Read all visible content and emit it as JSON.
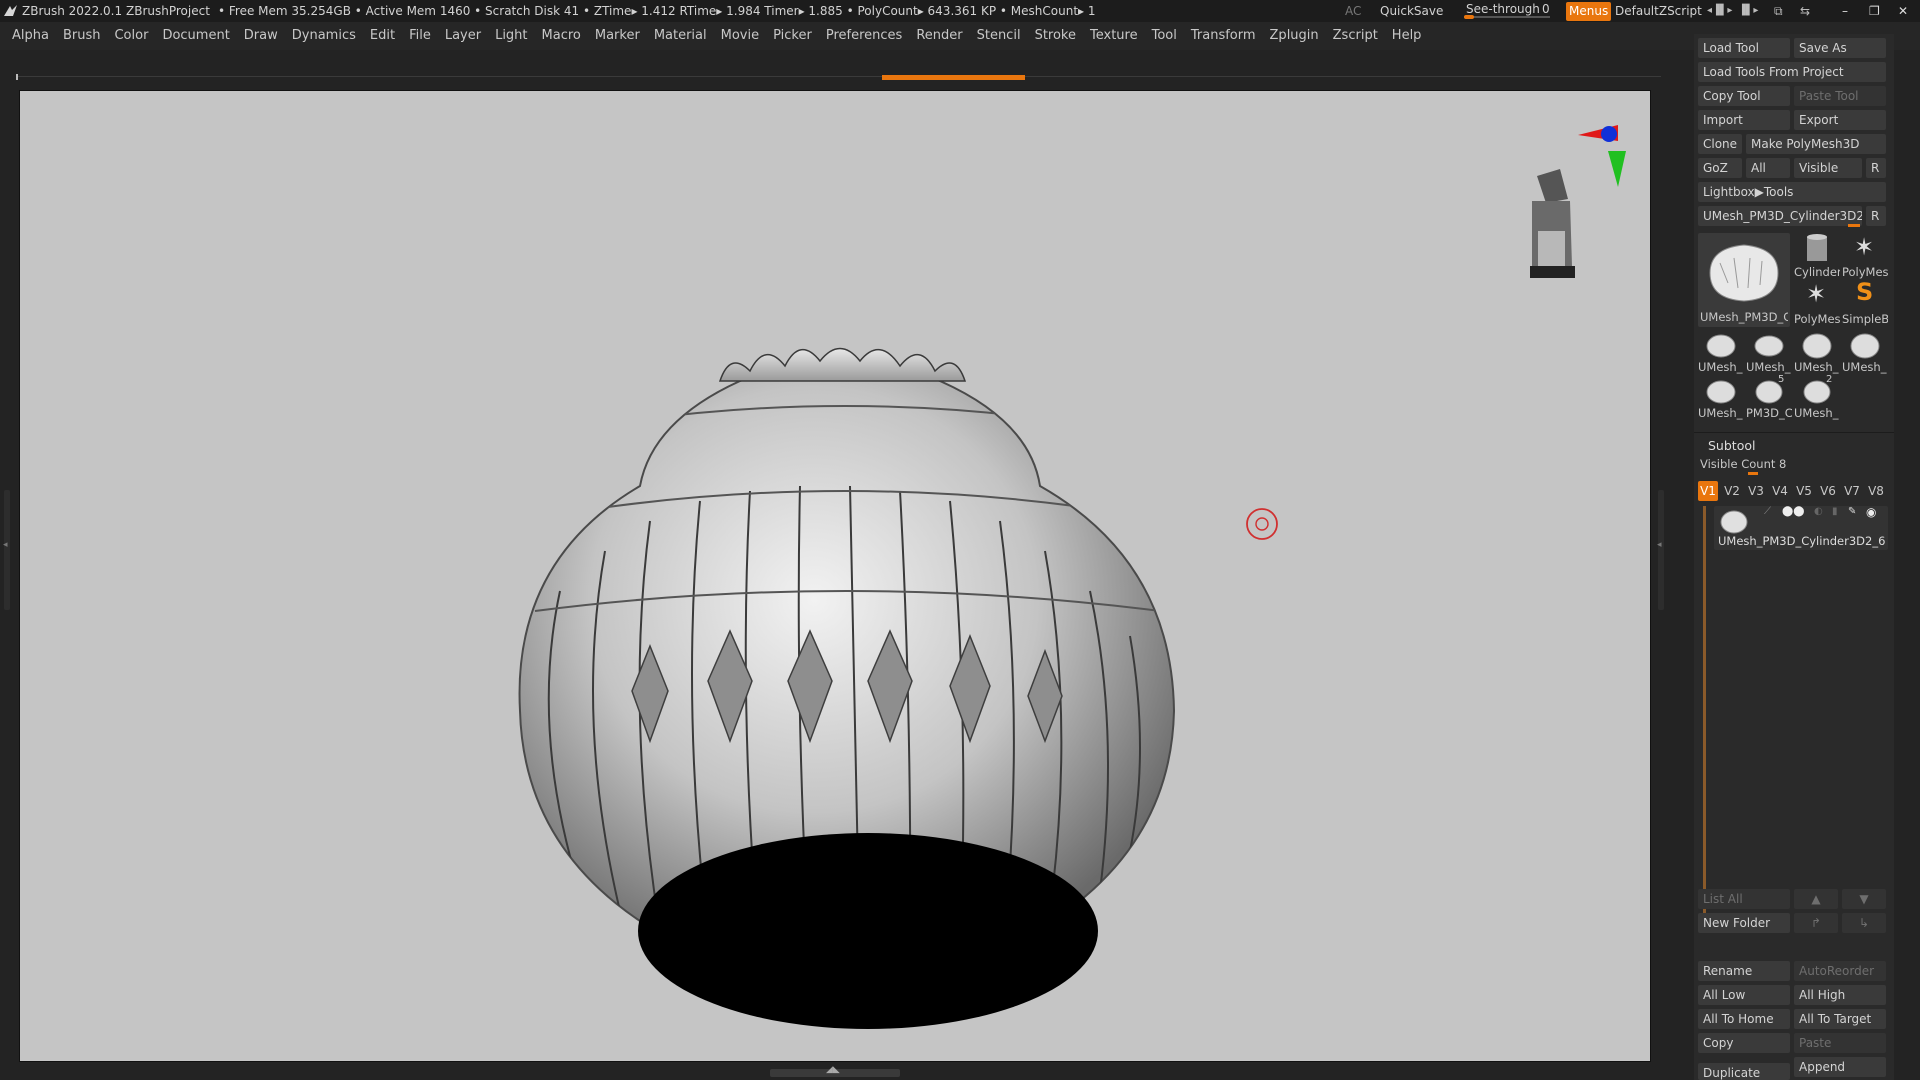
{
  "titlebar": {
    "app": "ZBrush 2022.0.1",
    "project": "ZBrushProject",
    "stats": "• Free Mem 35.254GB • Active Mem 1460 • Scratch Disk 41 •  ZTime▸ 1.412 RTime▸ 1.984 Timer▸ 1.885 • PolyCount▸ 643.361 KP  • MeshCount▸ 1",
    "ac": "AC",
    "quicksave": "QuickSave",
    "seethrough_label": "See-through",
    "seethrough_value": "0",
    "menus": "Menus",
    "script": "DefaultZScript"
  },
  "menubar": {
    "items": [
      "Alpha",
      "Brush",
      "Color",
      "Document",
      "Draw",
      "Dynamics",
      "Edit",
      "File",
      "Layer",
      "Light",
      "Macro",
      "Marker",
      "Material",
      "Movie",
      "Picker",
      "Preferences",
      "Render",
      "Stencil",
      "Stroke",
      "Texture",
      "Tool",
      "Transform",
      "Zplugin",
      "Zscript",
      "Help"
    ]
  },
  "tool_panel": {
    "load_tool": "Load Tool",
    "save_as": "Save As",
    "load_from_project": "Load Tools From Project",
    "copy_tool": "Copy Tool",
    "paste_tool": "Paste Tool",
    "import": "Import",
    "export": "Export",
    "clone": "Clone",
    "make_polymesh": "Make PolyMesh3D",
    "goz": "GoZ",
    "all": "All",
    "visible": "Visible",
    "r": "R",
    "lightbox_tools": "Lightbox▶Tools",
    "current_tool": "UMesh_PM3D_Cylinder3D2_6",
    "r2": "R",
    "thumbs": [
      "UMesh_PM3D_C",
      "Cylinder",
      "PolyMes",
      "PolyMes",
      "SimpleB",
      "UMesh_",
      "UMesh_",
      "UMesh_",
      "UMesh_",
      "UMesh_",
      "PM3D_C",
      "UMesh_"
    ],
    "thumb_marks": [
      "5",
      "2"
    ]
  },
  "subtool": {
    "title": "Subtool",
    "visible_count": "Visible Count 8",
    "versions": [
      "V1",
      "V2",
      "V3",
      "V4",
      "V5",
      "V6",
      "V7",
      "V8"
    ],
    "active_version": "V1",
    "item_name": "UMesh_PM3D_Cylinder3D2_6",
    "list_all": "List All",
    "new_folder": "New Folder",
    "rename": "Rename",
    "autoreorder": "AutoReorder",
    "all_low": "All Low",
    "all_high": "All High",
    "all_to_home": "All To Home",
    "all_to_target": "All To Target",
    "copy": "Copy",
    "paste": "Paste",
    "duplicate": "Duplicate",
    "append": "Append"
  },
  "colors": {
    "accent": "#e9760e",
    "viewport_bg": "#c5c5c5",
    "panel_bg": "#2a2a2a",
    "button_bg": "#3a3a3a"
  },
  "icons": [
    "zbrush-logo-icon",
    "axis-gizmo-icon",
    "navigation-mannequin-icon",
    "brush-cursor-icon",
    "arrow-up-icon",
    "arrow-down-icon",
    "folder-icon",
    "eye-icon",
    "brush-icon"
  ]
}
